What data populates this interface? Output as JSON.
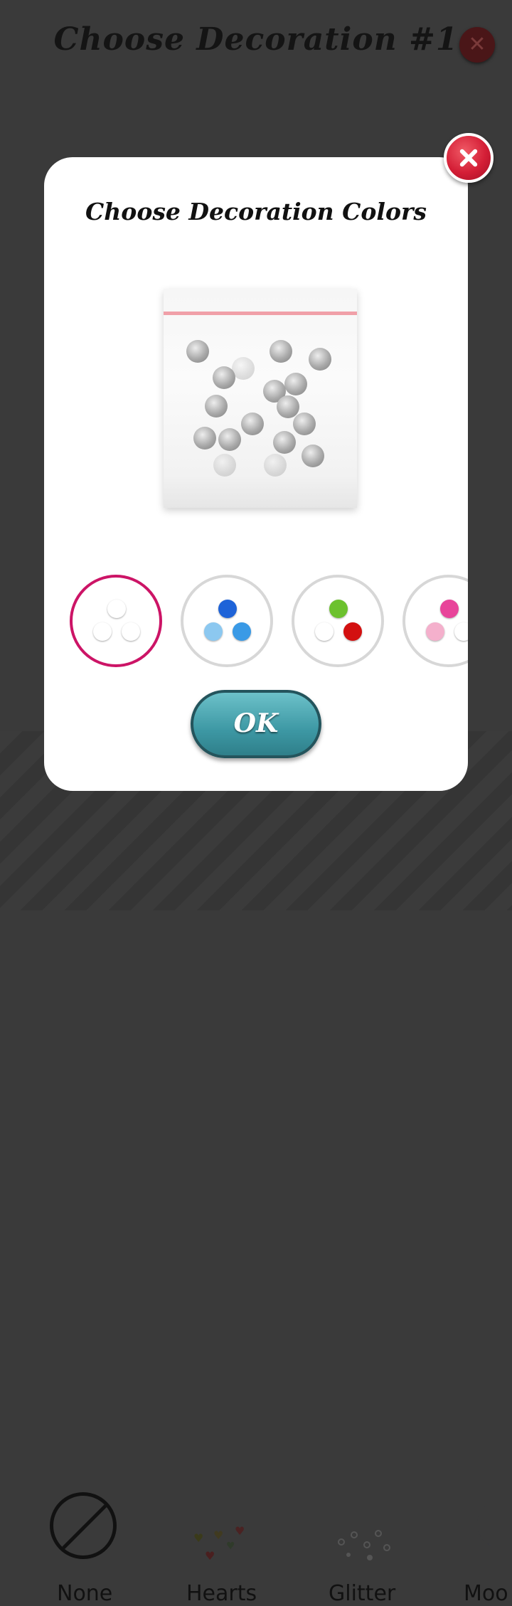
{
  "header": {
    "title": "Choose Decoration #1"
  },
  "categories": [
    {
      "label": "None",
      "icon": "none-icon"
    },
    {
      "label": "Hearts",
      "icon": "hearts-icon"
    },
    {
      "label": "Glitter",
      "icon": "glitter-icon"
    },
    {
      "label": "Moo",
      "icon": "moons-icon"
    }
  ],
  "modal": {
    "title": "Choose Decoration Colors",
    "ok_label": "OK",
    "preview_icon": "bead-bag-icon",
    "swatches": [
      {
        "name": "white",
        "colors": [
          "#ffffff",
          "#ffffff",
          "#ffffff"
        ],
        "selected": true
      },
      {
        "name": "blue",
        "colors": [
          "#1e63d8",
          "#8cc8f0",
          "#3a9ae6"
        ],
        "selected": false
      },
      {
        "name": "green-white-red",
        "colors": [
          "#6cc12e",
          "#ffffff",
          "#d31010"
        ],
        "selected": false
      },
      {
        "name": "pink",
        "colors": [
          "#e8449a",
          "#f4b0cc",
          "#ffffff"
        ],
        "selected": false
      }
    ]
  },
  "colors": {
    "selected_ring": "#cc1466",
    "close_button": "#d41e36",
    "ok_button": "#3d98a4"
  }
}
